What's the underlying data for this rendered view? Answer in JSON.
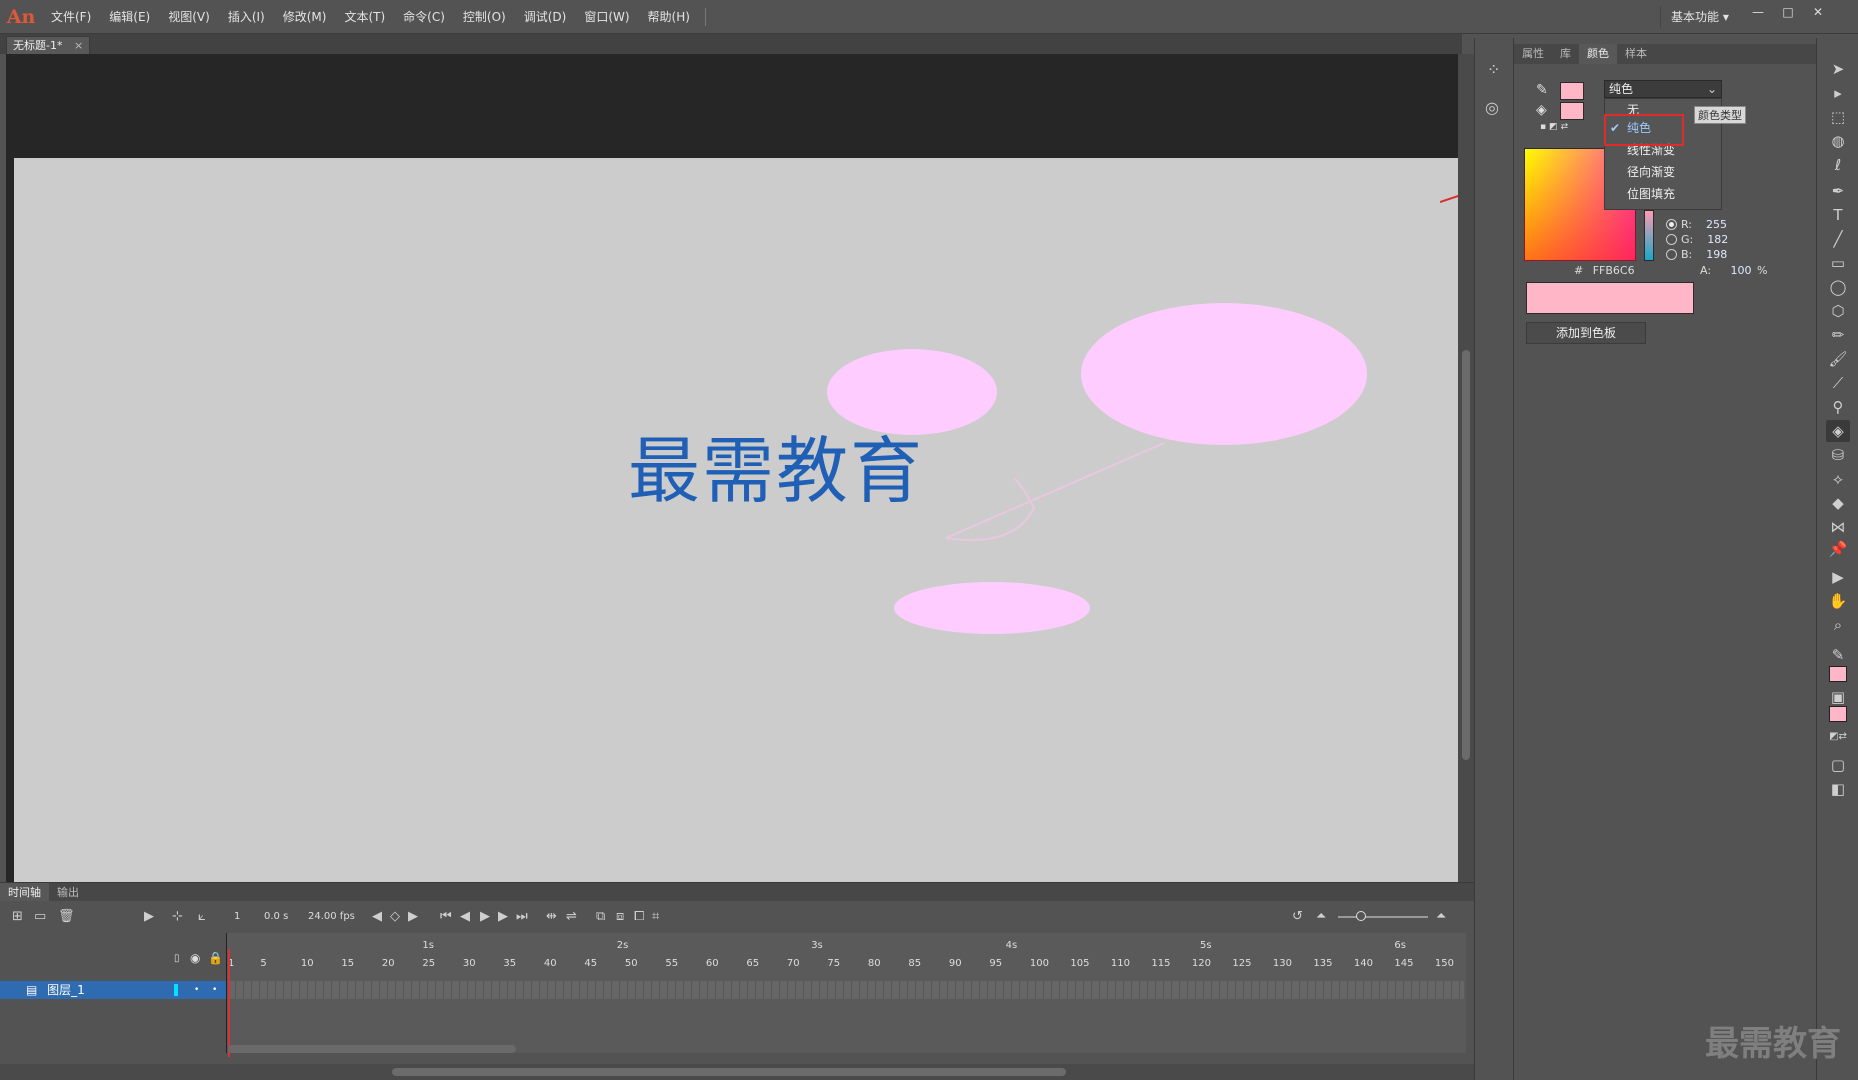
{
  "app": {
    "logo": "An",
    "workspace": "基本功能 ▾",
    "window_min": "—",
    "window_max": "□",
    "window_close": "✕"
  },
  "menu": [
    "文件(F)",
    "编辑(E)",
    "视图(V)",
    "插入(I)",
    "修改(M)",
    "文本(T)",
    "命令(C)",
    "控制(O)",
    "调试(D)",
    "窗口(W)",
    "帮助(H)"
  ],
  "document": {
    "tab_title": "无标题-1*",
    "tab_close": "×"
  },
  "stage": {
    "text": "最需教育",
    "text_color": "#1f5fb5",
    "shape_fill": "#ffccff",
    "background": "#cccccc"
  },
  "panel": {
    "tabs": [
      "属性",
      "库",
      "颜色",
      "样本"
    ],
    "active_tab": "颜色",
    "color_type": {
      "selected": "纯色",
      "options": [
        "无",
        "纯色",
        "线性渐变",
        "径向渐变",
        "位图填充"
      ],
      "tooltip": "颜色类型"
    },
    "rgb": {
      "r_label": "R:",
      "r": "255",
      "g_label": "G:",
      "g": "182",
      "b_label": "B:",
      "b": "198"
    },
    "hex_label": "#",
    "hex": "FFB6C6",
    "alpha_label": "A:",
    "alpha": "100",
    "alpha_unit": "%",
    "add_swatch": "添加到色板",
    "current_color": "#ffb6c6"
  },
  "timeline": {
    "tabs": [
      "时间轴",
      "输出"
    ],
    "current_frame": "1",
    "time": "0.0 s",
    "fps": "24.00 fps",
    "seconds": [
      "1s",
      "2s",
      "3s",
      "4s",
      "5s",
      "6s"
    ],
    "frame_numbers": [
      "1",
      "5",
      "10",
      "15",
      "20",
      "25",
      "30",
      "35",
      "40",
      "45",
      "50",
      "55",
      "60",
      "65",
      "70",
      "75",
      "80",
      "85",
      "90",
      "95",
      "100",
      "105",
      "110",
      "115",
      "120",
      "125",
      "130",
      "135",
      "140",
      "145",
      "150"
    ],
    "layer_name": "图层_1"
  },
  "watermark": "最需教育"
}
